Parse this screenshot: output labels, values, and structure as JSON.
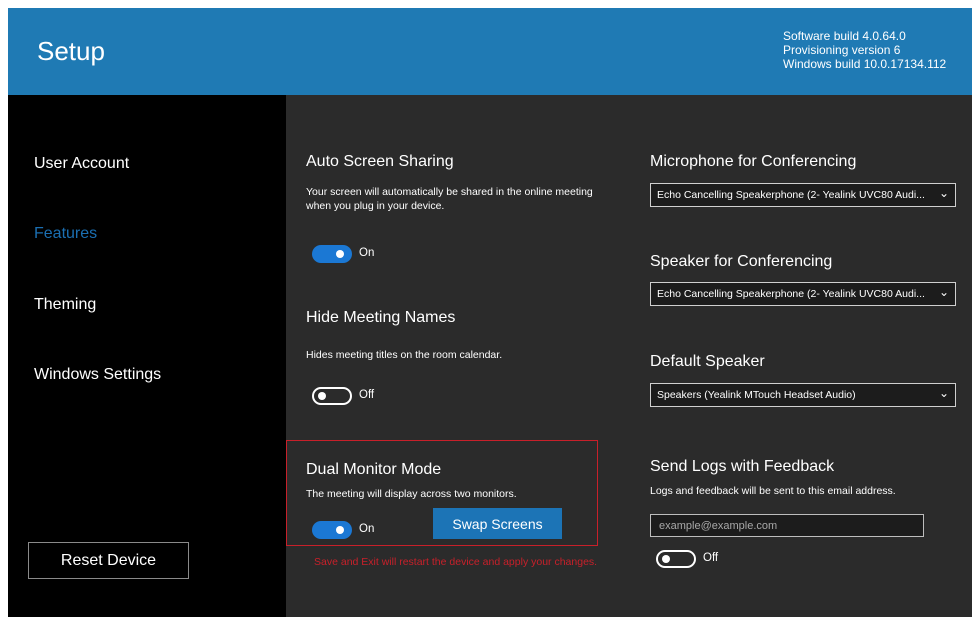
{
  "header": {
    "title": "Setup",
    "software_build": "Software build 4.0.64.0",
    "provisioning": "Provisioning version 6",
    "windows_build": "Windows build 10.0.17134.112"
  },
  "sidebar": {
    "items": [
      {
        "label": "User Account",
        "active": false
      },
      {
        "label": "Features",
        "active": true
      },
      {
        "label": "Theming",
        "active": false
      },
      {
        "label": "Windows Settings",
        "active": false
      }
    ],
    "reset_label": "Reset Device"
  },
  "features": {
    "auto_share": {
      "title": "Auto Screen Sharing",
      "desc": "Your screen will automatically be shared in the online meeting when you plug in your device.",
      "toggle_label": "On"
    },
    "hide_names": {
      "title": "Hide Meeting Names",
      "desc": "Hides meeting titles on the room calendar.",
      "toggle_label": "Off"
    },
    "dual_monitor": {
      "title": "Dual Monitor Mode",
      "desc": "The meeting will display across two monitors.",
      "toggle_label": "On",
      "swap_label": "Swap Screens"
    },
    "warning": "Save and Exit will restart the device and apply your changes."
  },
  "audio": {
    "microphone": {
      "title": "Microphone for Conferencing",
      "value": "Echo Cancelling Speakerphone (2- Yealink UVC80 Audi..."
    },
    "speaker": {
      "title": "Speaker for Conferencing",
      "value": "Echo Cancelling Speakerphone (2- Yealink UVC80 Audi..."
    },
    "default_speaker": {
      "title": "Default Speaker",
      "value": "Speakers (Yealink MTouch Headset Audio)"
    },
    "logs": {
      "title": "Send Logs with Feedback",
      "desc": "Logs and feedback will be sent to this email address.",
      "placeholder": "example@example.com",
      "toggle_label": "Off"
    }
  },
  "icons": {
    "chevron": "chevron-down-icon"
  },
  "colors": {
    "header": "#1f7ab4",
    "accent": "#1b78d4",
    "active_nav": "#1b6fb2",
    "warning": "#c8202a",
    "sidebar": "#000000",
    "main": "#2b2b2b"
  }
}
